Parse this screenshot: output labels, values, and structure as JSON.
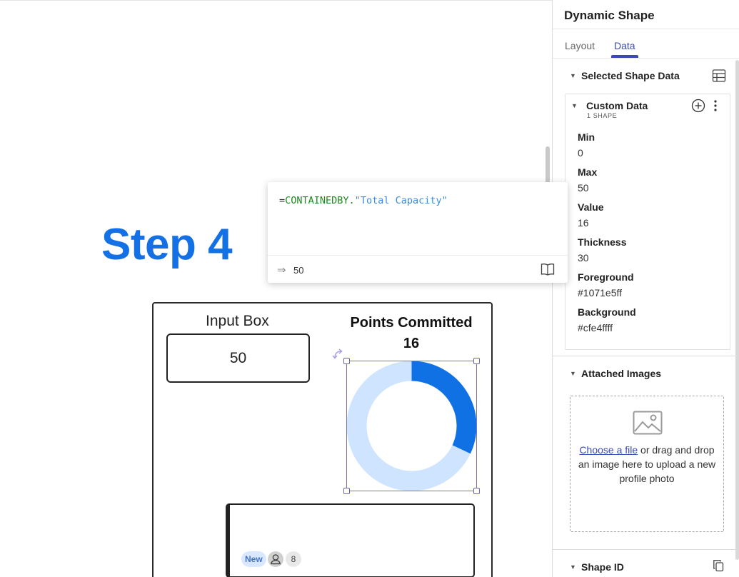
{
  "canvas": {
    "step_title": "Step 4",
    "formula": {
      "eq": "=",
      "fn": "CONTAINEDBY.",
      "str": "\"Total Capacity\"",
      "result_arrow": "⇒",
      "result": "50"
    },
    "frame": {
      "input_label": "Input Box",
      "input_value": "50",
      "points_title": "Points Committed",
      "points_value": "16"
    },
    "gauge": {
      "min": 0,
      "max": 50,
      "value": 16,
      "foreground": "#1071e5",
      "background": "#cfe4ff"
    },
    "card": {
      "badge": "New",
      "count": "8"
    }
  },
  "panel": {
    "title": "Dynamic Shape",
    "tabs": [
      {
        "label": "Layout",
        "active": false
      },
      {
        "label": "Data",
        "active": true
      }
    ],
    "selected_shape_data": {
      "heading": "Selected Shape Data",
      "custom_data": {
        "title": "Custom Data",
        "subtitle": "1 SHAPE",
        "fields": [
          {
            "label": "Min",
            "value": "0"
          },
          {
            "label": "Max",
            "value": "50"
          },
          {
            "label": "Value",
            "value": "16"
          },
          {
            "label": "Thickness",
            "value": "30"
          },
          {
            "label": "Foreground",
            "value": "#1071e5ff"
          },
          {
            "label": "Background",
            "value": "#cfe4ffff"
          }
        ]
      }
    },
    "attached_images": {
      "heading": "Attached Images",
      "link": "Choose a file",
      "text_after_link": " or drag and drop an image here to upload a new profile photo"
    },
    "shape_id": {
      "heading": "Shape ID"
    }
  },
  "colors": {
    "accent": "#3a49b8",
    "step_blue": "#1471e5"
  }
}
